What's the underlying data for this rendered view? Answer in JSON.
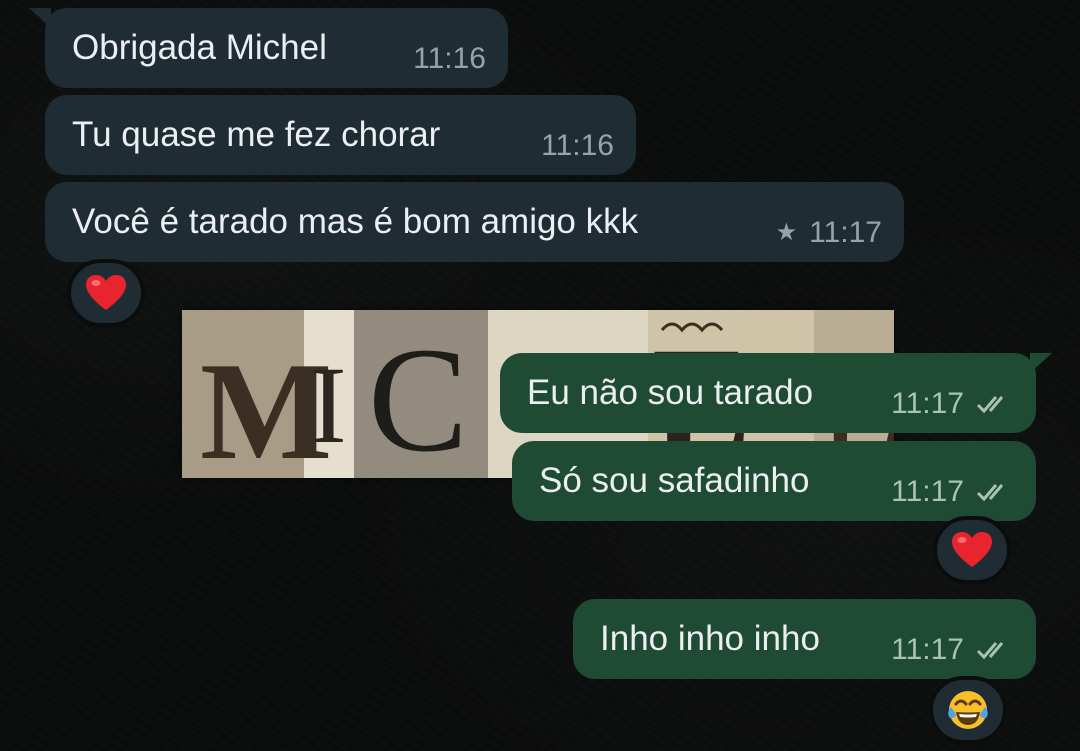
{
  "messages": [
    {
      "direction": "incoming",
      "text": "Obrigada Michel",
      "time": "11:16"
    },
    {
      "direction": "incoming",
      "text": "Tu quase me fez chorar",
      "time": "11:16"
    },
    {
      "direction": "incoming",
      "text": "Você é tarado mas é bom amigo kkk",
      "time": "11:17",
      "starred": true,
      "reaction": "heart-emoji"
    },
    {
      "direction": "incoming",
      "type": "sticker",
      "sticker_text": "MICHEL"
    },
    {
      "direction": "outgoing",
      "text": "Eu não sou tarado",
      "time": "11:17",
      "status": "double-check-icon"
    },
    {
      "direction": "outgoing",
      "text": "Só sou safadinho",
      "time": "11:17",
      "status": "double-check-icon",
      "reaction": "heart-emoji"
    },
    {
      "direction": "outgoing",
      "text": "Inho inho inho",
      "time": "11:17",
      "status": "double-check-icon",
      "reaction": "tears-of-joy-emoji"
    }
  ],
  "colors": {
    "background": "#0b0c0c",
    "incoming_bubble": "#1f2c33",
    "outgoing_bubble": "#1f4a33",
    "message_text": "#eceff1",
    "meta_text": "#95a3aa"
  }
}
